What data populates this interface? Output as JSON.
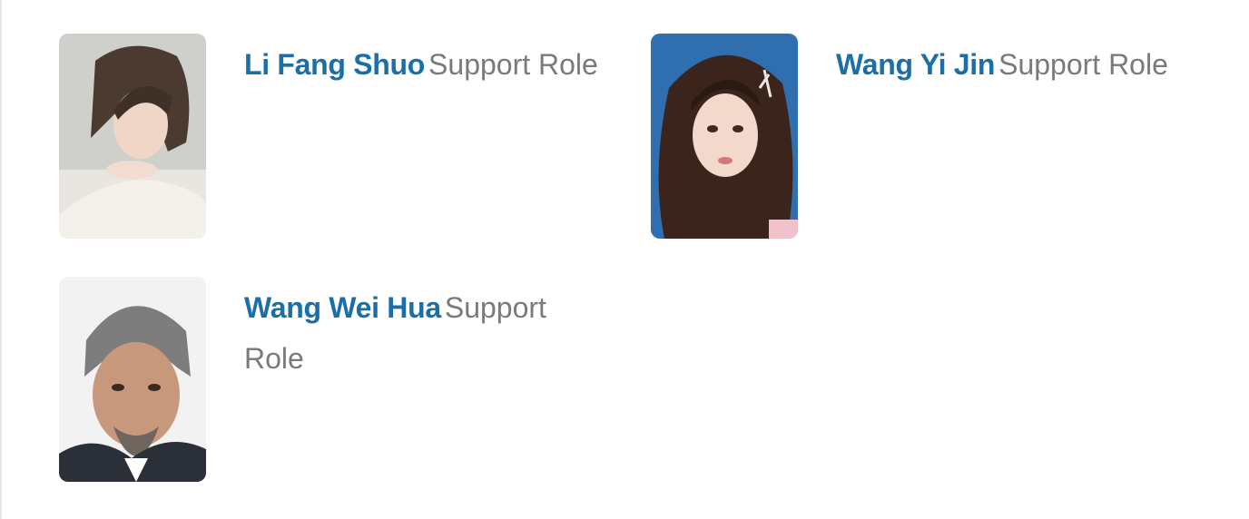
{
  "cast": [
    {
      "name": "Li Fang Shuo",
      "role": "Support Role",
      "photo": "portrait-li-fang-shuo"
    },
    {
      "name": "Wang Yi Jin",
      "role": "Support Role",
      "photo": "portrait-wang-yi-jin"
    },
    {
      "name": "Wang Wei Hua",
      "role": "Support Role",
      "photo": "portrait-wang-wei-hua"
    }
  ],
  "colors": {
    "name_link": "#1a6fa8",
    "role_text": "#7a7a7a",
    "divider": "#e6e6e6"
  }
}
